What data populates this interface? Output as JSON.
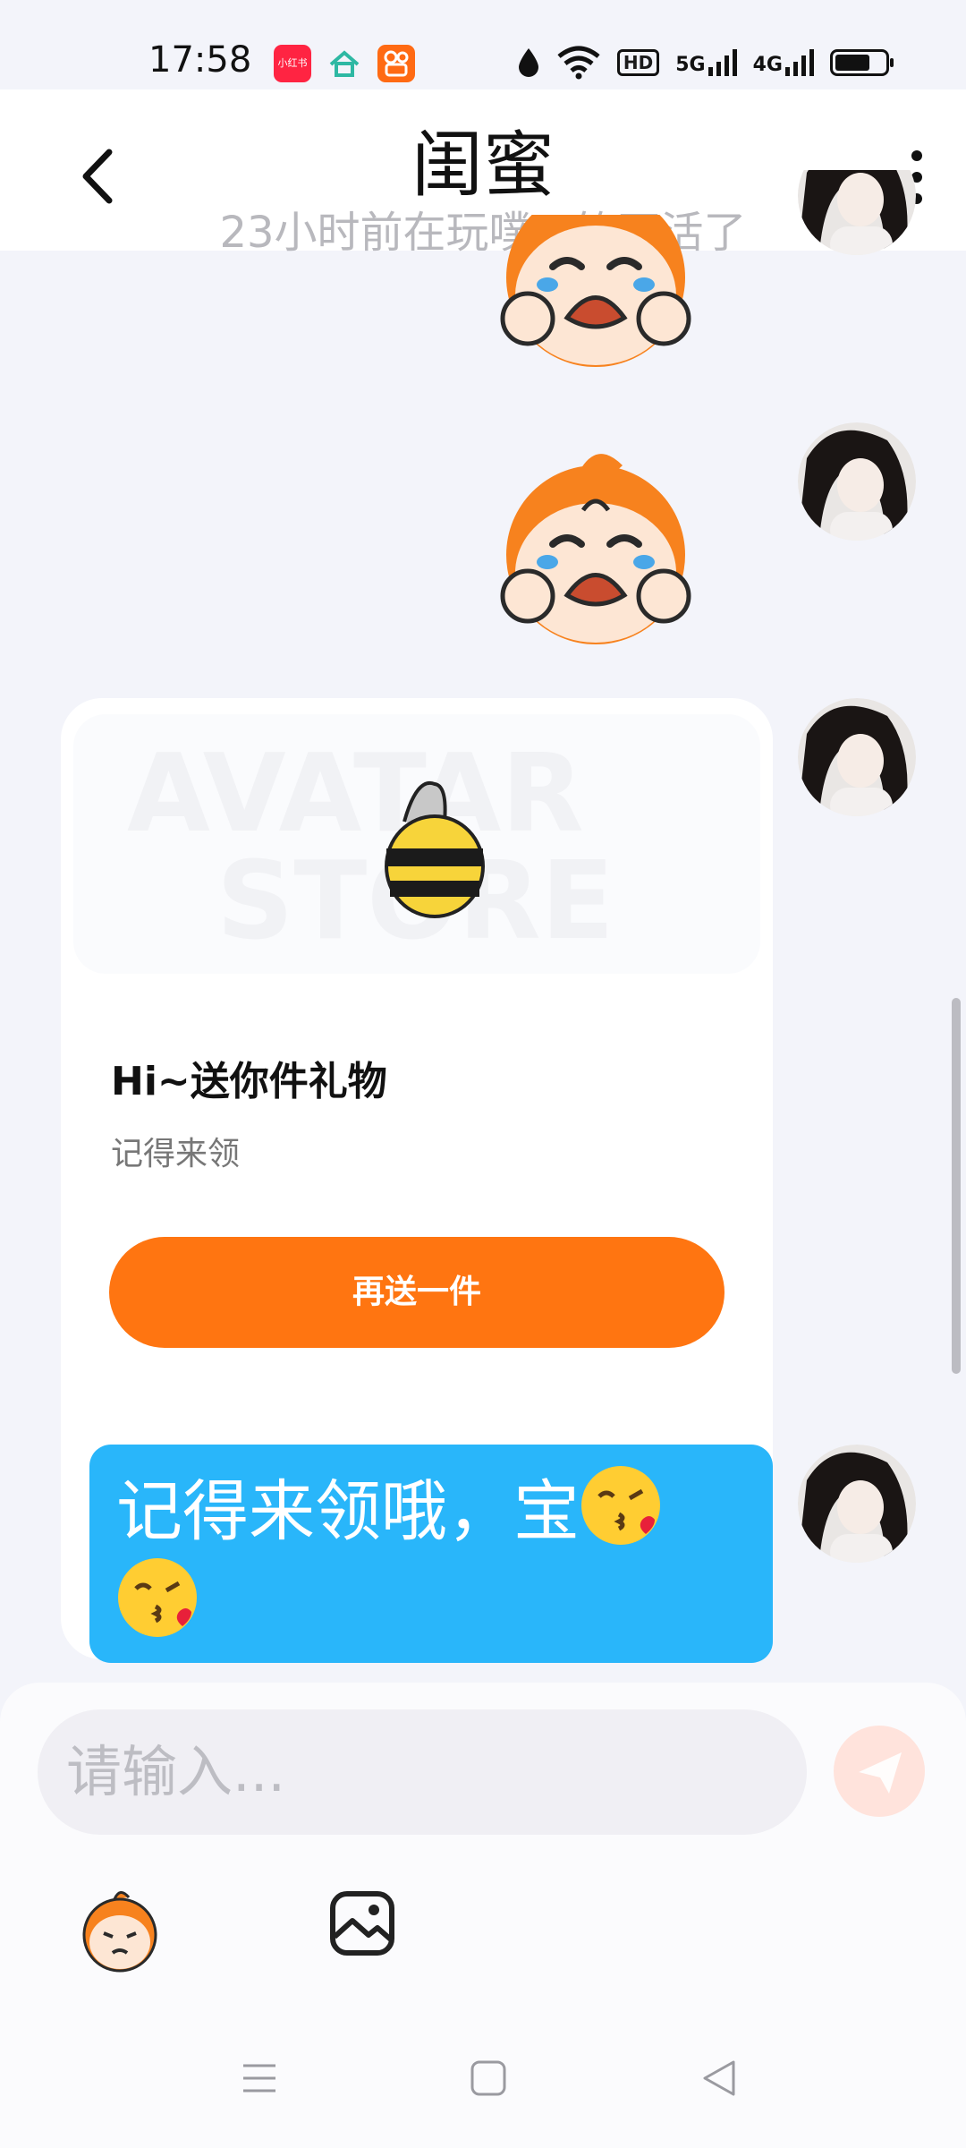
{
  "status_bar": {
    "time": "17:58",
    "app_icons": [
      "xiaohongshu-icon",
      "smart-home-icon",
      "kuaishou-icon"
    ],
    "net1": "5G",
    "net2": "4G",
    "hd": "HD",
    "battery_level": 0.7
  },
  "header": {
    "title": "闺蜜",
    "subtitle": "23小时前在玩噗！笑不活了"
  },
  "chat": {
    "gift_card": {
      "title": "Hi~送你件礼物",
      "subtitle": "记得来领",
      "button_label": "再送一件",
      "banner_watermark_1": "AVATAR",
      "banner_watermark_2": "STORE"
    },
    "message_text": "记得来领哦，宝"
  },
  "input": {
    "placeholder": "请输入..."
  },
  "colors": {
    "accent_orange": "#ff7511",
    "bubble_blue": "#29b6fa",
    "background": "#f3f4fa"
  }
}
